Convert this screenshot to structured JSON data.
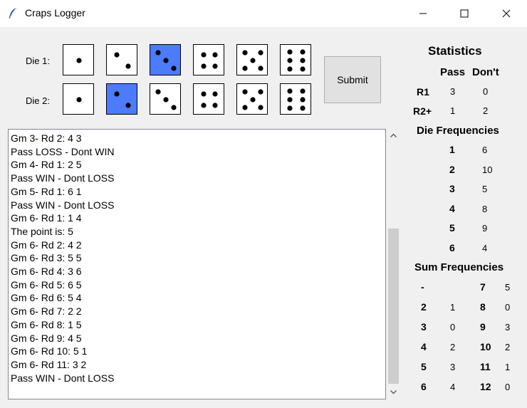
{
  "window": {
    "title": "Craps Logger"
  },
  "dice": {
    "die1_label": "Die 1:",
    "die2_label": "Die 2:",
    "die1_selected": 3,
    "die2_selected": 2
  },
  "submit_label": "Submit",
  "log_lines": [
    "Gm 3- Rd 2: 4 3",
    "Pass LOSS - Dont WIN",
    "Gm 4- Rd 1: 2 5",
    "Pass WIN - Dont LOSS",
    "Gm 5- Rd 1: 6 1",
    "Pass WIN - Dont LOSS",
    "Gm 6- Rd 1: 1 4",
    "The point is: 5",
    "Gm 6- Rd 2: 4 2",
    "Gm 6- Rd 3: 5 5",
    "Gm 6- Rd 4: 3 6",
    "Gm 6- Rd 5: 6 5",
    "Gm 6- Rd 6: 5 4",
    "Gm 6- Rd 7: 2 2",
    "Gm 6- Rd 8: 1 5",
    "Gm 6- Rd 9: 4 5",
    "Gm 6- Rd 10: 5 1",
    "Gm 6- Rd 11: 3 2",
    "Pass WIN - Dont LOSS"
  ],
  "stats": {
    "title": "Statistics",
    "pass_header": "Pass",
    "dont_header": "Don't",
    "rounds": [
      {
        "label": "R1",
        "pass": "3",
        "dont": "0"
      },
      {
        "label": "R2+",
        "pass": "1",
        "dont": "2"
      }
    ],
    "die_freq_title": "Die Frequencies",
    "die_freq": [
      {
        "face": "1",
        "count": "6"
      },
      {
        "face": "2",
        "count": "10"
      },
      {
        "face": "3",
        "count": "5"
      },
      {
        "face": "4",
        "count": "8"
      },
      {
        "face": "5",
        "count": "9"
      },
      {
        "face": "6",
        "count": "4"
      }
    ],
    "sum_freq_title": "Sum Frequencies",
    "sum_freq_left": [
      {
        "sum": "-",
        "count": ""
      },
      {
        "sum": "2",
        "count": "1"
      },
      {
        "sum": "3",
        "count": "0"
      },
      {
        "sum": "4",
        "count": "2"
      },
      {
        "sum": "5",
        "count": "3"
      },
      {
        "sum": "6",
        "count": "4"
      }
    ],
    "sum_freq_right": [
      {
        "sum": "7",
        "count": "5"
      },
      {
        "sum": "8",
        "count": "0"
      },
      {
        "sum": "9",
        "count": "3"
      },
      {
        "sum": "10",
        "count": "2"
      },
      {
        "sum": "11",
        "count": "1"
      },
      {
        "sum": "12",
        "count": "0"
      }
    ]
  },
  "colors": {
    "selected_die": "#4c7bfb"
  }
}
